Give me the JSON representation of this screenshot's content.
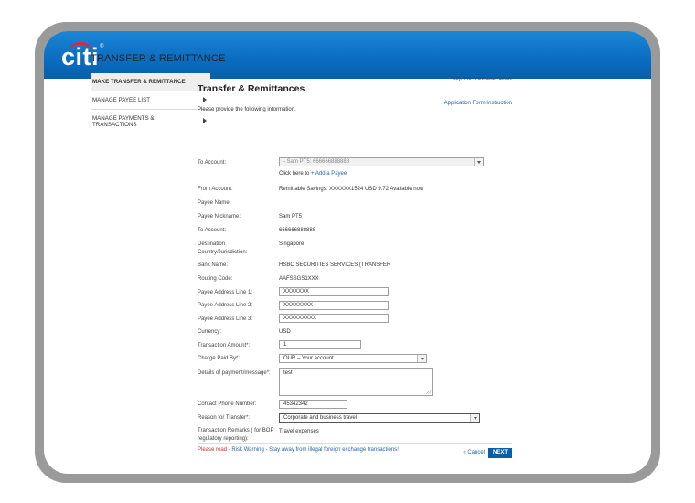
{
  "brand": {
    "logo_text": "citi",
    "logo_reg": "®"
  },
  "page": {
    "title": "TRANSFER & REMITTANCE"
  },
  "sidebar": {
    "items": [
      {
        "label": "MAKE TRANSFER & REMITTANCE",
        "active": true
      },
      {
        "label": "MANAGE PAYEE LIST"
      },
      {
        "label": "MANAGE PAYMENTS & TRANSACTIONS"
      }
    ]
  },
  "form": {
    "step": "Step 1 of 3: Provide Details",
    "title": "Transfer & Remittances",
    "app_form_link": "Application Form Instruction",
    "intro": "Please provide the following information.",
    "to_account_label": "To Account:",
    "to_account_value": "- Sam PT5: 666666888888",
    "add_payee_prefix": "Click here to",
    "add_payee_link": "+ Add a Payee",
    "from_account_label": "From Account:",
    "from_account_value": "Remittable Savings: XXXXXX1524 USD 9.72 Available now",
    "payee_name_label": "Payee Name:",
    "payee_nickname_label": "Payee Nickname:",
    "payee_nickname_value": "Sam PT5",
    "to_account2_label": "To Account:",
    "to_account2_value": "666666888888",
    "destination_label_1": "Destination",
    "destination_label_2": "Country/Jurisdiction:",
    "destination_value": "Singapore",
    "bank_name_label": "Bank Name:",
    "bank_name_value": "HSBC SECURITIES SERVICES (TRANSFER",
    "routing_label": "Routing Code:",
    "routing_value": "AAFSSGS1XXX",
    "addr1_label": "Payee Address Line 1:",
    "addr1_value": "XXXXXXX",
    "addr2_label": "Payee Address Line 2:",
    "addr2_value": "XXXXXXXX",
    "addr3_label": "Payee Address Line 3:",
    "addr3_value": "XXXXXXXXX",
    "currency_label": "Currency:",
    "currency_value": "USD",
    "amount_label": "Transaction Amount*:",
    "amount_value": "1",
    "charge_label": "Charge Paid By*:",
    "charge_value": "OUR – Your account",
    "details_label": "Details of payment/message*:",
    "details_value": "test",
    "phone_label": "Contact Phone Number:",
    "phone_value": "45342342",
    "reason_label": "Reason for Transfer*:",
    "reason_value": "Corporate and business travel",
    "remarks_label_1": "Transaction Remarks ( for BOP",
    "remarks_label_2": "regulatory reporting):",
    "remarks_value": "Travel expenses"
  },
  "footer": {
    "please_read": "Please read",
    "risk_warning": "- Risk Warning - Stay away from illegal foreign exchange transactions!",
    "cancel": "« Cancel",
    "next": "NEXT"
  },
  "colors": {
    "brand_blue": "#0b6cc0",
    "link_blue": "#2466b0",
    "warning_red": "#d42a2a",
    "logo_arc_red": "#e3262e"
  }
}
